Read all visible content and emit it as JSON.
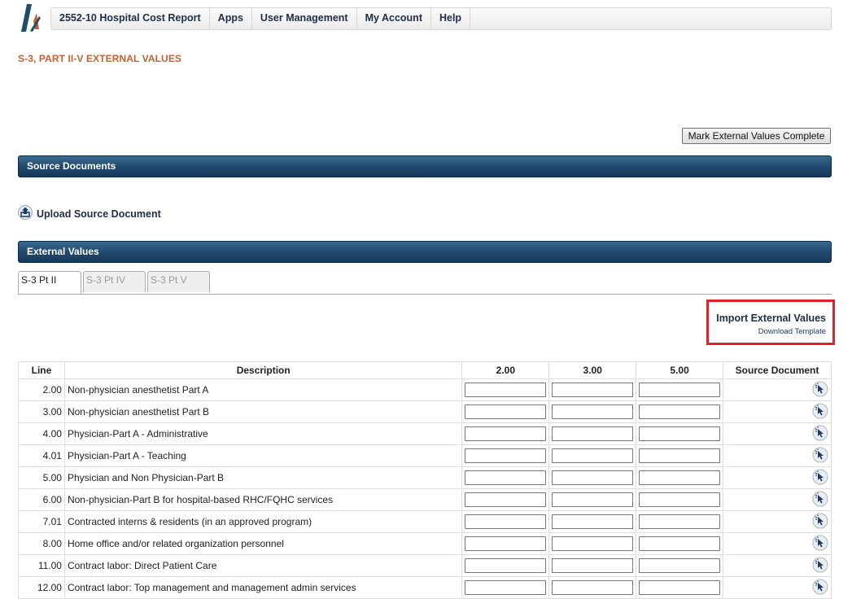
{
  "nav": {
    "items": [
      {
        "label": "2552-10 Hospital Cost Report"
      },
      {
        "label": "Apps"
      },
      {
        "label": "User Management"
      },
      {
        "label": "My Account"
      },
      {
        "label": "Help"
      }
    ]
  },
  "page_title": "S-3, PART II-V EXTERNAL VALUES",
  "mark_complete_label": "Mark External Values Complete",
  "sections": {
    "source_documents": "Source Documents",
    "external_values": "External Values"
  },
  "upload_label": "Upload Source Document",
  "tabs": [
    {
      "label": "S-3 Pt II",
      "active": true
    },
    {
      "label": "S-3 Pt IV",
      "active": false
    },
    {
      "label": "S-3 Pt V",
      "active": false
    }
  ],
  "import": {
    "title": "Import External Values",
    "download": "Download Template"
  },
  "table": {
    "headers": [
      "Line",
      "Description",
      "2.00",
      "3.00",
      "5.00",
      "Source Document"
    ],
    "rows": [
      {
        "line": "2.00",
        "desc": "Non-physician anesthetist Part A",
        "v2": "",
        "v3": "",
        "v5": ""
      },
      {
        "line": "3.00",
        "desc": "Non-physician anesthetist Part B",
        "v2": "",
        "v3": "",
        "v5": ""
      },
      {
        "line": "4.00",
        "desc": "Physician-Part A - Administrative",
        "v2": "",
        "v3": "",
        "v5": ""
      },
      {
        "line": "4.01",
        "desc": "Physician-Part A - Teaching",
        "v2": "",
        "v3": "",
        "v5": ""
      },
      {
        "line": "5.00",
        "desc": "Physician and Non Physician-Part B",
        "v2": "",
        "v3": "",
        "v5": ""
      },
      {
        "line": "6.00",
        "desc": "Non-physician-Part B for hospital-based RHC/FQHC services",
        "v2": "",
        "v3": "",
        "v5": ""
      },
      {
        "line": "7.01",
        "desc": "Contracted interns & residents (in an approved program)",
        "v2": "",
        "v3": "",
        "v5": ""
      },
      {
        "line": "8.00",
        "desc": "Home office and/or related organization personnel",
        "v2": "",
        "v3": "",
        "v5": ""
      },
      {
        "line": "11.00",
        "desc": "Contract labor: Direct Patient Care",
        "v2": "",
        "v3": "",
        "v5": ""
      },
      {
        "line": "12.00",
        "desc": "Contract labor: Top management and management admin services",
        "v2": "",
        "v3": "",
        "v5": ""
      }
    ]
  },
  "icons": {
    "logo": "app-logo",
    "upload": "upload-icon",
    "source_picker": "cursor-select-icon"
  },
  "colors": {
    "title_orange": "#c8612e",
    "bar_blue": "#22496e",
    "highlight_red": "#e0202a",
    "nav_text": "#1f2d45"
  }
}
